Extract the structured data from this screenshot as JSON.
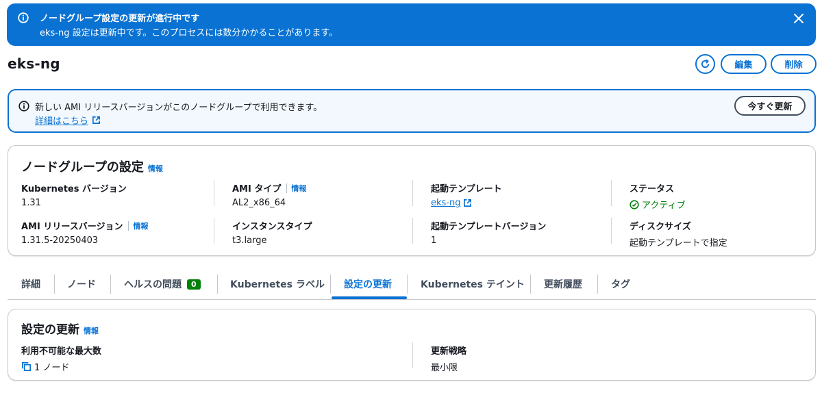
{
  "flash": {
    "title": "ノードグループ設定の更新が進行中です",
    "message": "eks-ng 設定は更新中です。このプロセスには数分かかることがあります。"
  },
  "header": {
    "title": "eks-ng",
    "edit_label": "編集",
    "delete_label": "削除"
  },
  "alert": {
    "message": "新しい AMI リリースバージョンがこのノードグループで利用できます。",
    "link_label": "詳細はこちら",
    "button_label": "今すぐ更新"
  },
  "config": {
    "title": "ノードグループの設定",
    "info": "情報",
    "fields": [
      {
        "label": "Kubernetes バージョン",
        "value": "1.31"
      },
      {
        "label": "AMI タイプ",
        "info": "情報",
        "value": "AL2_x86_64"
      },
      {
        "label": "起動テンプレート",
        "value": "eks-ng"
      },
      {
        "label": "ステータス",
        "value": "アクティブ"
      },
      {
        "label": "AMI リリースバージョン",
        "info": "情報",
        "value": "1.31.5-20250403"
      },
      {
        "label": "インスタンスタイプ",
        "value": "t3.large"
      },
      {
        "label": "起動テンプレートバージョン",
        "value": "1"
      },
      {
        "label": "ディスクサイズ",
        "value": "起動テンプレートで指定"
      }
    ]
  },
  "tabs": [
    {
      "label": "詳細"
    },
    {
      "label": "ノード"
    },
    {
      "label": "ヘルスの問題",
      "badge": "0"
    },
    {
      "label": "Kubernetes ラベル"
    },
    {
      "label": "設定の更新"
    },
    {
      "label": "Kubernetes テイント"
    },
    {
      "label": "更新履歴"
    },
    {
      "label": "タグ"
    }
  ],
  "update_config": {
    "title": "設定の更新",
    "info": "情報",
    "max_unavailable_label": "利用不可能な最大数",
    "max_unavailable_value": "1 ノード",
    "strategy_label": "更新戦略",
    "strategy_value": "最小限"
  },
  "colors": {
    "primary": "#0972d3",
    "success": "#037f0c",
    "text": "#16191f"
  }
}
